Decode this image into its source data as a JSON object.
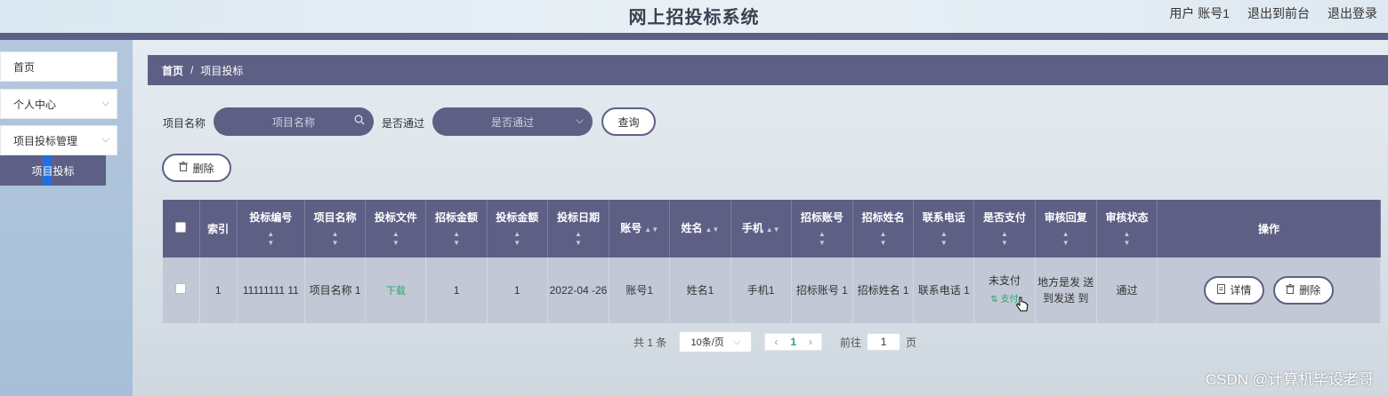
{
  "header": {
    "title": "网上招投标系统",
    "user": "用户 账号1",
    "to_front": "退出到前台",
    "logout": "退出登录"
  },
  "sidebar": {
    "items": [
      {
        "label": "首页"
      },
      {
        "label": "个人中心"
      },
      {
        "label": "项目投标管理"
      }
    ],
    "sub_item": "项目投标"
  },
  "breadcrumb": {
    "home": "首页",
    "separator": "/",
    "current": "项目投标"
  },
  "search": {
    "name_label": "项目名称",
    "name_placeholder": "项目名称",
    "pass_label": "是否通过",
    "pass_placeholder": "是否通过",
    "query_button": "查询"
  },
  "actions": {
    "delete_button": "删除"
  },
  "table": {
    "columns": [
      "索引",
      "投标编号",
      "项目名称",
      "投标文件",
      "招标金额",
      "投标金额",
      "投标日期",
      "账号",
      "姓名",
      "手机",
      "招标账号",
      "招标姓名",
      "联系电话",
      "是否支付",
      "审核回复",
      "审核状态",
      "操作"
    ],
    "row": {
      "index": "1",
      "bid_no": "11111111 11",
      "project_name": "项目名称 1",
      "bid_file": "下载",
      "tender_amount": "1",
      "bid_amount": "1",
      "bid_date": "2022-04 -26",
      "account": "账号1",
      "name": "姓名1",
      "phone": "手机1",
      "tender_account": "招标账号 1",
      "tender_name": "招标姓名 1",
      "contact_phone": "联系电话 1",
      "paid": "未支付",
      "pay_link": "支付",
      "review_reply": "地方是发 送到发送 到",
      "review_status": "通过",
      "detail_button": "详情",
      "delete_button": "删除"
    }
  },
  "pager": {
    "total": "共 1 条",
    "page_size": "10条/页",
    "current_page": "1",
    "goto_label": "前往",
    "goto_value": "1",
    "page_unit": "页"
  },
  "watermark": "CSDN @计算机毕设老哥",
  "colors": {
    "primary": "#5e5f85",
    "link_green": "#2aa86f",
    "row_bg": "#c3c8d6",
    "active_marker": "#1f6fe0"
  }
}
